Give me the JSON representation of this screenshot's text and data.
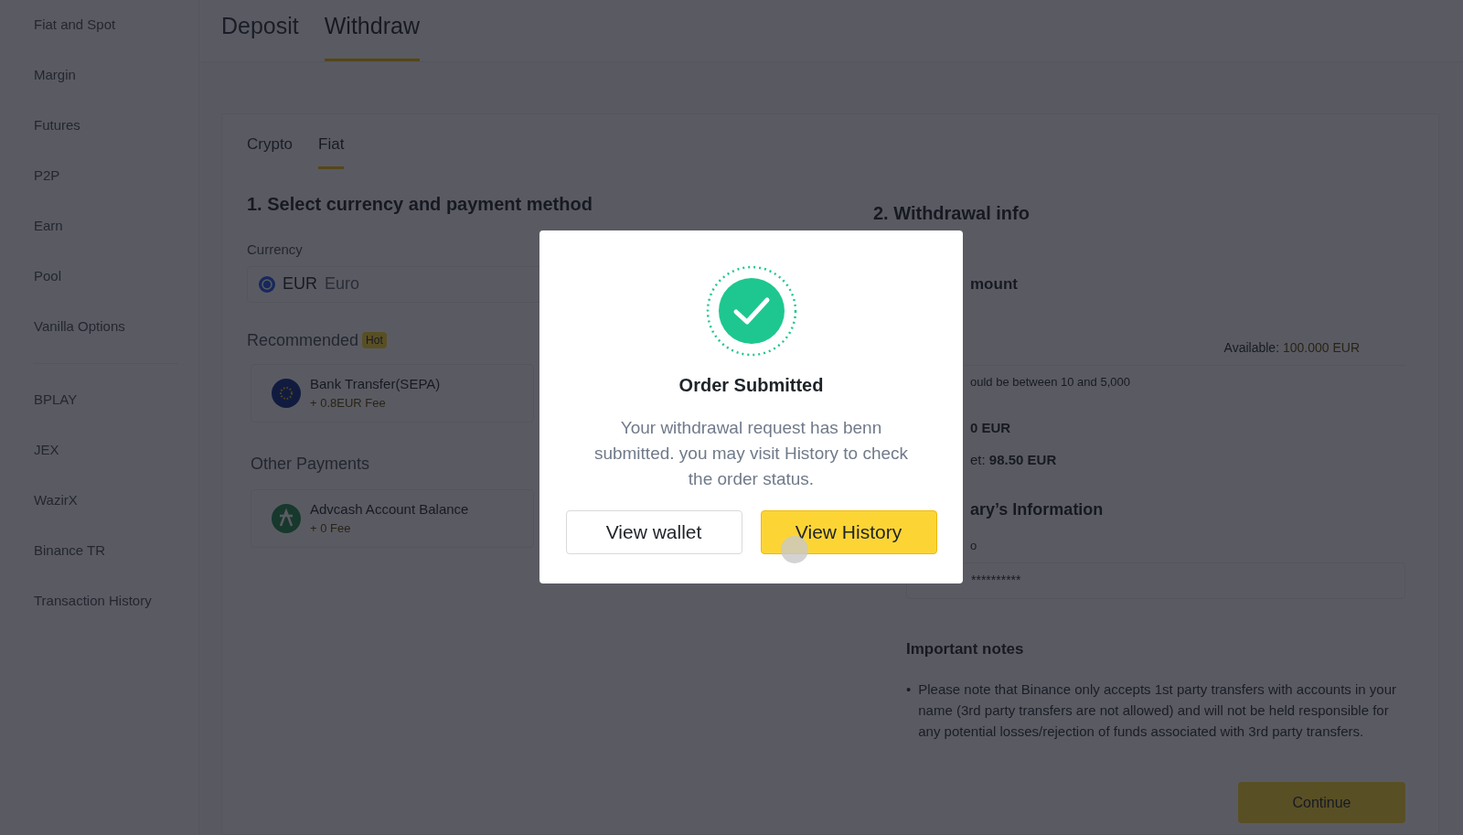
{
  "sidebar": {
    "groups": [
      [
        "Fiat and Spot",
        "Margin",
        "Futures",
        "P2P",
        "Earn",
        "Pool",
        "Vanilla Options"
      ],
      [
        "BPLAY",
        "JEX",
        "WazirX",
        "Binance TR",
        "Transaction History"
      ]
    ]
  },
  "tabs": [
    {
      "label": "Deposit",
      "selected": false
    },
    {
      "label": "Withdraw",
      "selected": true
    }
  ],
  "subtabs": [
    {
      "label": "Crypto",
      "selected": false
    },
    {
      "label": "Fiat",
      "selected": true
    }
  ],
  "section1": {
    "title": "1. Select currency and payment method",
    "currency": {
      "label": "Currency",
      "code": "EUR",
      "name": "Euro"
    },
    "recommended": {
      "title": "Recommended",
      "badge": "Hot",
      "methods": [
        {
          "kind": "sepa",
          "name": "Bank Transfer(SEPA)",
          "fee": "+ 0.8EUR Fee"
        }
      ]
    },
    "other": {
      "title": "Other Payments",
      "methods": [
        {
          "kind": "advcash",
          "name": "Advcash Account Balance",
          "fee": "+ 0 Fee"
        }
      ]
    }
  },
  "section2": {
    "title": "2. Withdrawal info",
    "amount_label": "mount",
    "available": {
      "label": "Available:",
      "value": "100.000",
      "unit": "EUR"
    },
    "range_hint": "ould be between 10 and 5,000",
    "fee_value": "0 EUR",
    "receive": {
      "label": "et:",
      "value": "98.50 EUR"
    },
    "beneficiary_title": "ary’s Information",
    "field_label": "o",
    "field_value": "**********",
    "notes": {
      "title": "Important notes",
      "bullet": "•",
      "items": [
        "Please note that Binance only accepts 1st party transfers with accounts in your name (3rd party transfers are not allowed) and will not be held responsible for any potential losses/rejection of funds associated with 3rd party transfers."
      ]
    },
    "continue_button": "Continue"
  },
  "modal": {
    "title": "Order Submitted",
    "message": "Your withdrawal request has benn submitted. you  may visit History to check the order status.",
    "buttons": [
      {
        "kind": "secondary",
        "label": "View wallet"
      },
      {
        "kind": "primary",
        "label": "View History"
      }
    ]
  }
}
